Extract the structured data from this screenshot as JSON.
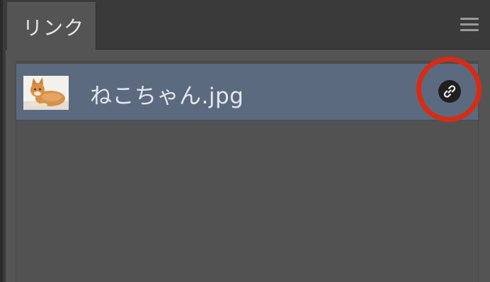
{
  "panel": {
    "tab_label": "リンク",
    "menu_icon": "hamburger-menu-icon"
  },
  "links": [
    {
      "file_name": "ねこちゃん.jpg",
      "thumbnail_icon": "cat-photo-thumbnail",
      "status_icon": "link-chain-icon"
    }
  ],
  "colors": {
    "selected_row": "#5b6a7f",
    "highlight_ring": "#d92b14"
  }
}
